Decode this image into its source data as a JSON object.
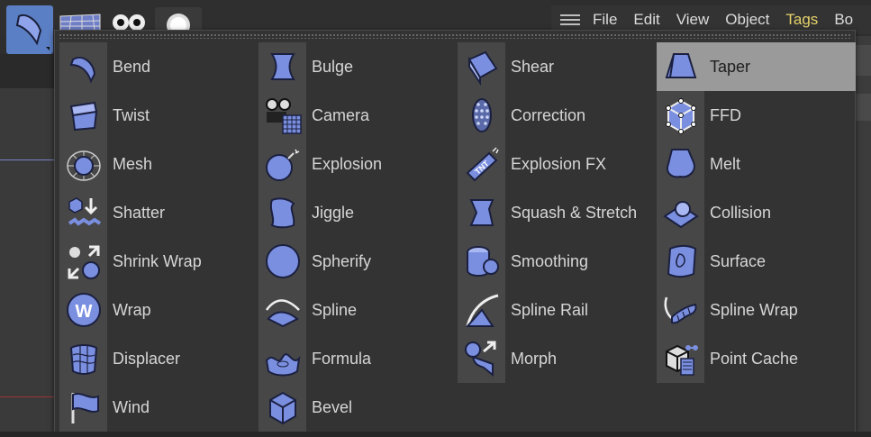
{
  "menubar": {
    "items": [
      {
        "label": "File"
      },
      {
        "label": "Edit"
      },
      {
        "label": "View"
      },
      {
        "label": "Object"
      },
      {
        "label": "Tags"
      },
      {
        "label": "Bo"
      }
    ]
  },
  "toolbar": {
    "active_tool_icon": "bend-deformer-icon"
  },
  "deformer_menu": {
    "columns": [
      [
        {
          "label": "Bend",
          "icon": "bend-icon"
        },
        {
          "label": "Twist",
          "icon": "twist-icon"
        },
        {
          "label": "Mesh",
          "icon": "mesh-icon"
        },
        {
          "label": "Shatter",
          "icon": "shatter-icon"
        },
        {
          "label": "Shrink Wrap",
          "icon": "shrink-wrap-icon"
        },
        {
          "label": "Wrap",
          "icon": "wrap-icon"
        },
        {
          "label": "Displacer",
          "icon": "displacer-icon"
        },
        {
          "label": "Wind",
          "icon": "wind-icon"
        }
      ],
      [
        {
          "label": "Bulge",
          "icon": "bulge-icon"
        },
        {
          "label": "Camera",
          "icon": "camera-icon"
        },
        {
          "label": "Explosion",
          "icon": "explosion-icon"
        },
        {
          "label": "Jiggle",
          "icon": "jiggle-icon"
        },
        {
          "label": "Spherify",
          "icon": "spherify-icon"
        },
        {
          "label": "Spline",
          "icon": "spline-icon"
        },
        {
          "label": "Formula",
          "icon": "formula-icon"
        },
        {
          "label": "Bevel",
          "icon": "bevel-icon"
        }
      ],
      [
        {
          "label": "Shear",
          "icon": "shear-icon"
        },
        {
          "label": "Correction",
          "icon": "correction-icon"
        },
        {
          "label": "Explosion FX",
          "icon": "explosion-fx-icon"
        },
        {
          "label": "Squash & Stretch",
          "icon": "squash-stretch-icon"
        },
        {
          "label": "Smoothing",
          "icon": "smoothing-icon"
        },
        {
          "label": "Spline Rail",
          "icon": "spline-rail-icon"
        },
        {
          "label": "Morph",
          "icon": "morph-icon"
        }
      ],
      [
        {
          "label": "Taper",
          "icon": "taper-icon",
          "selected": true
        },
        {
          "label": "FFD",
          "icon": "ffd-icon"
        },
        {
          "label": "Melt",
          "icon": "melt-icon"
        },
        {
          "label": "Collision",
          "icon": "collision-icon"
        },
        {
          "label": "Surface",
          "icon": "surface-icon"
        },
        {
          "label": "Spline Wrap",
          "icon": "spline-wrap-icon"
        },
        {
          "label": "Point Cache",
          "icon": "point-cache-icon"
        }
      ]
    ]
  },
  "colors": {
    "menu_bg": "#333333",
    "icon_tile": "#474747",
    "selected_bg": "#9a9a9a",
    "icon_blue": "#7b8fe0",
    "accent_menu": "#e6d36a"
  }
}
